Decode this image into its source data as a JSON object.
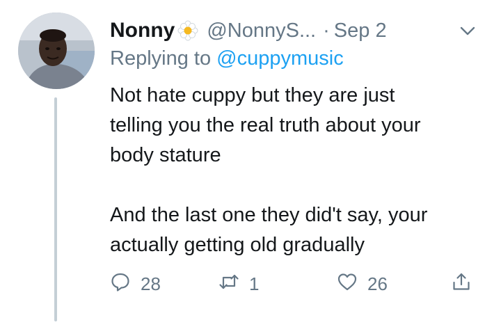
{
  "tweet": {
    "author_name": "Nonny",
    "author_handle": "@NonnyS...",
    "separator": "·",
    "date": "Sep 2",
    "replying_prefix": "Replying to",
    "replying_to": "@cuppymusic",
    "body_lines": [
      "Not hate cuppy but they are just",
      "telling you the real truth about your",
      "body stature",
      "And the last one they did't say, your",
      "actually getting old gradually"
    ],
    "replies": "28",
    "retweets": "1",
    "likes": "26"
  },
  "colors": {
    "text": "#14171a",
    "secondary": "#657786",
    "link": "#1da1f2",
    "thread_line": "#c4cfd6"
  },
  "icons": {
    "avatar": "avatar",
    "badge": "flower-icon",
    "menu": "chevron-down-icon",
    "reply": "reply-icon",
    "retweet": "retweet-icon",
    "like": "heart-icon",
    "share": "share-icon"
  }
}
